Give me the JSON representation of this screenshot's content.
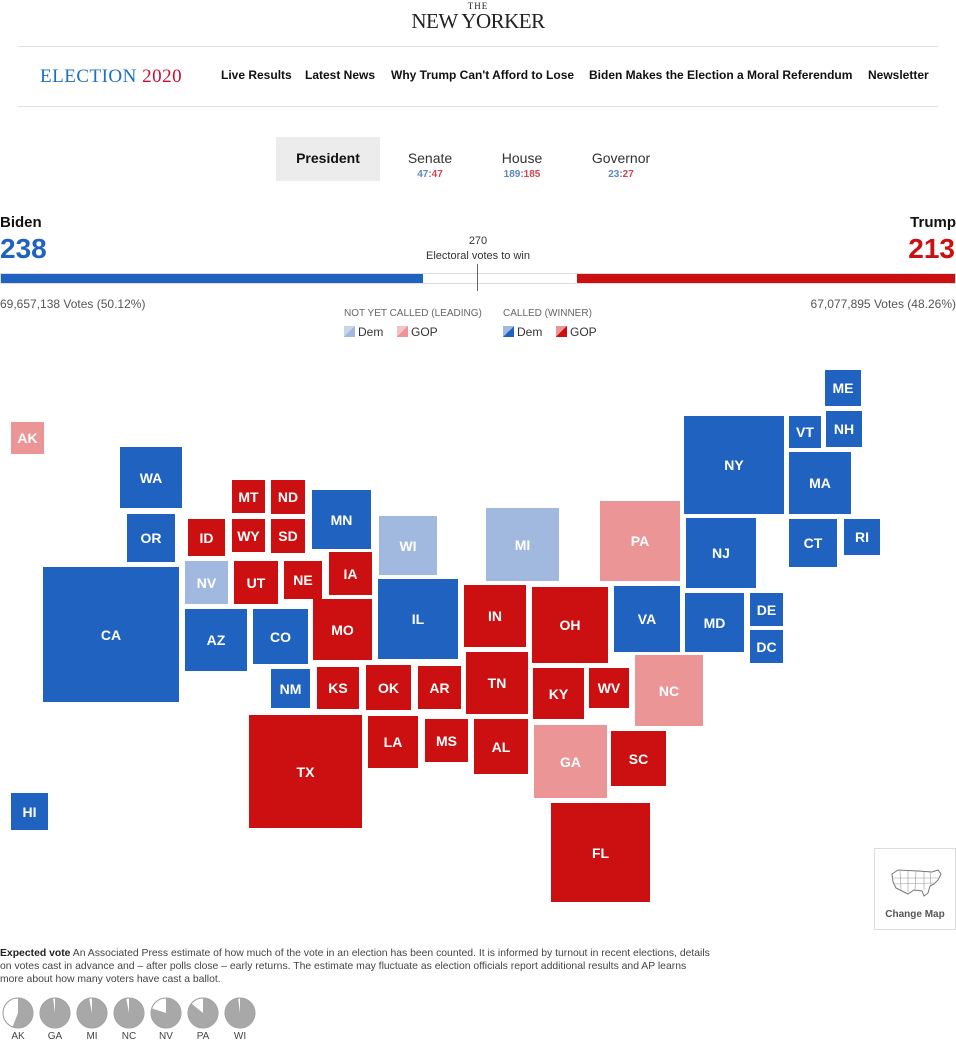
{
  "masthead": {
    "the": "THE",
    "name": "NEW YORKER"
  },
  "nav": {
    "brand_word": "ELECTION",
    "brand_year": "2020",
    "links": [
      "Live Results",
      "Latest News",
      "Why Trump Can't Afford to Lose",
      "Biden Makes the Election a Moral Referendum",
      "Newsletter"
    ]
  },
  "race_tabs": [
    {
      "label": "President"
    },
    {
      "label": "Senate",
      "dem": "47",
      "sep": ":",
      "gop": "47"
    },
    {
      "label": "House",
      "dem": "189",
      "sep": ":",
      "gop": "185"
    },
    {
      "label": "Governor",
      "dem": "23",
      "sep": ":",
      "gop": "27"
    }
  ],
  "tally": {
    "dem_name": "Biden",
    "dem_ev": "238",
    "dem_votes": "69,657,138 Votes (50.12%)",
    "gop_name": "Trump",
    "gop_ev": "213",
    "gop_votes": "67,077,895 Votes (48.26%)",
    "threshold": "270",
    "threshold_label": "Electoral votes to win",
    "dem_ev_value": 238,
    "gop_ev_value": 213,
    "total_ev": 538
  },
  "legend": {
    "not_called": "NOT YET CALLED (LEADING)",
    "called": "CALLED (WINNER)",
    "dem": "Dem",
    "gop": "GOP"
  },
  "colors": {
    "dem": "#1f62bf",
    "gop": "#cc1011",
    "dem_leading": "#a1b9de",
    "gop_leading": "#eb9596"
  },
  "states": [
    {
      "abbr": "AK",
      "status": "lgop"
    },
    {
      "abbr": "HI",
      "status": "dem"
    },
    {
      "abbr": "WA",
      "status": "dem"
    },
    {
      "abbr": "OR",
      "status": "dem"
    },
    {
      "abbr": "CA",
      "status": "dem"
    },
    {
      "abbr": "ID",
      "status": "gop"
    },
    {
      "abbr": "MT",
      "status": "gop"
    },
    {
      "abbr": "WY",
      "status": "gop"
    },
    {
      "abbr": "ND",
      "status": "gop"
    },
    {
      "abbr": "SD",
      "status": "gop"
    },
    {
      "abbr": "NV",
      "status": "ldem"
    },
    {
      "abbr": "UT",
      "status": "gop"
    },
    {
      "abbr": "AZ",
      "status": "dem"
    },
    {
      "abbr": "CO",
      "status": "dem"
    },
    {
      "abbr": "NM",
      "status": "dem"
    },
    {
      "abbr": "NE",
      "status": "gop"
    },
    {
      "abbr": "KS",
      "status": "gop"
    },
    {
      "abbr": "OK",
      "status": "gop"
    },
    {
      "abbr": "TX",
      "status": "gop"
    },
    {
      "abbr": "MN",
      "status": "dem"
    },
    {
      "abbr": "IA",
      "status": "gop"
    },
    {
      "abbr": "MO",
      "status": "gop"
    },
    {
      "abbr": "AR",
      "status": "gop"
    },
    {
      "abbr": "LA",
      "status": "gop"
    },
    {
      "abbr": "MS",
      "status": "gop"
    },
    {
      "abbr": "WI",
      "status": "ldem"
    },
    {
      "abbr": "IL",
      "status": "dem"
    },
    {
      "abbr": "MI",
      "status": "ldem"
    },
    {
      "abbr": "IN",
      "status": "gop"
    },
    {
      "abbr": "TN",
      "status": "gop"
    },
    {
      "abbr": "AL",
      "status": "gop"
    },
    {
      "abbr": "OH",
      "status": "gop"
    },
    {
      "abbr": "KY",
      "status": "gop"
    },
    {
      "abbr": "WV",
      "status": "gop"
    },
    {
      "abbr": "GA",
      "status": "lgop"
    },
    {
      "abbr": "FL",
      "status": "gop"
    },
    {
      "abbr": "SC",
      "status": "gop"
    },
    {
      "abbr": "NC",
      "status": "lgop"
    },
    {
      "abbr": "VA",
      "status": "dem"
    },
    {
      "abbr": "PA",
      "status": "lgop"
    },
    {
      "abbr": "MD",
      "status": "dem"
    },
    {
      "abbr": "DE",
      "status": "dem"
    },
    {
      "abbr": "DC",
      "status": "dem"
    },
    {
      "abbr": "NJ",
      "status": "dem"
    },
    {
      "abbr": "NY",
      "status": "dem"
    },
    {
      "abbr": "CT",
      "status": "dem"
    },
    {
      "abbr": "RI",
      "status": "dem"
    },
    {
      "abbr": "MA",
      "status": "dem"
    },
    {
      "abbr": "VT",
      "status": "dem"
    },
    {
      "abbr": "NH",
      "status": "dem"
    },
    {
      "abbr": "ME",
      "status": "dem"
    }
  ],
  "change_map": {
    "label": "Change Map",
    "icon": "us-map-icon"
  },
  "expected_vote": {
    "title": "Expected vote",
    "text": "An Associated Press estimate of how much of the vote in an election has been counted. It is informed by turnout in recent elections, details on votes cast in advance and – after polls close – early returns. The estimate may fluctuate as election officials report additional results and AP learns more about how many voters have cast a ballot.",
    "pies": [
      {
        "label": "AK",
        "pct": 56
      },
      {
        "label": "GA",
        "pct": 98
      },
      {
        "label": "MI",
        "pct": 97
      },
      {
        "label": "NC",
        "pct": 97
      },
      {
        "label": "NV",
        "pct": 80
      },
      {
        "label": "PA",
        "pct": 86
      },
      {
        "label": "WI",
        "pct": 98
      }
    ]
  }
}
